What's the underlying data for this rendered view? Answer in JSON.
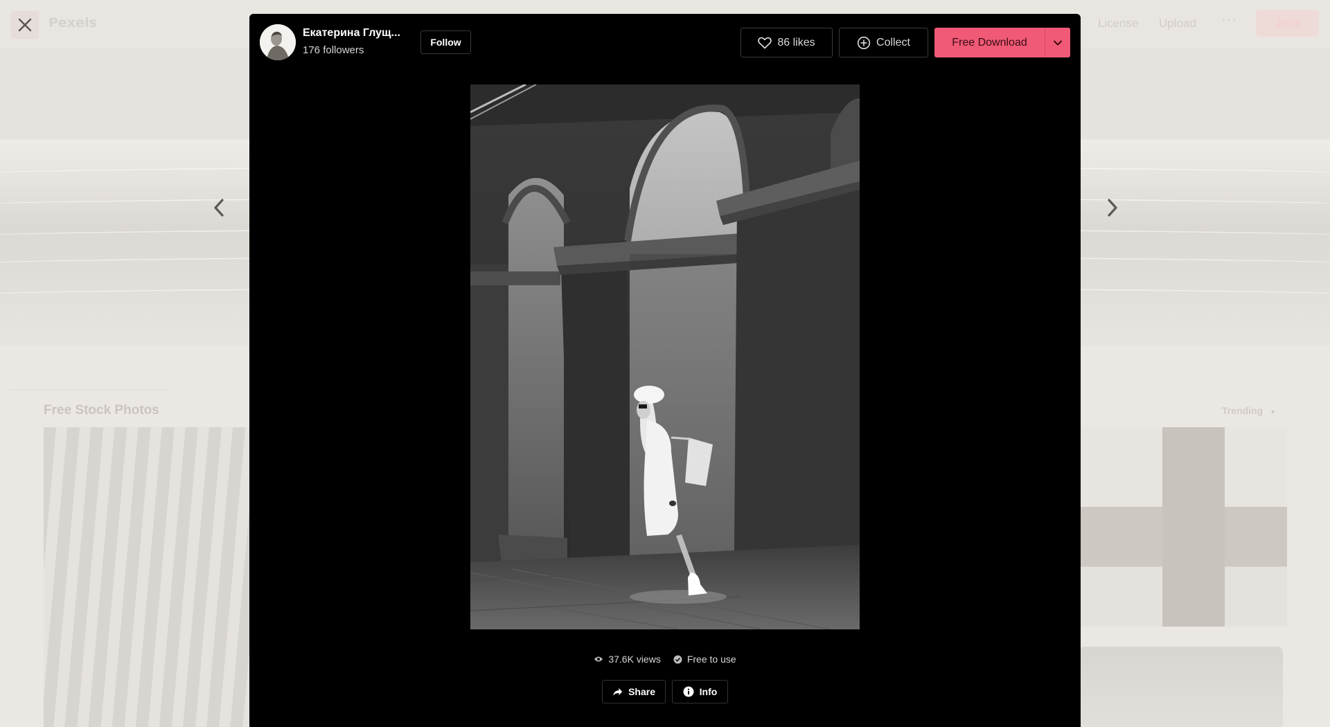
{
  "background_page": {
    "logo": "Pexels",
    "nav": {
      "license": "License",
      "upload": "Upload",
      "more": "···",
      "join": "Join"
    },
    "section_title": "Free Stock Photos",
    "sort": "Trending"
  },
  "modal": {
    "author": {
      "name": "Екатерина Глущ...",
      "followers": "176 followers"
    },
    "follow_label": "Follow",
    "likes_label": "86 likes",
    "collect_label": "Collect",
    "download_label": "Free Download",
    "views": "37.6K views",
    "license": "Free to use",
    "share_label": "Share",
    "info_label": "Info"
  },
  "colors": {
    "accent": "#f05a76",
    "modal_bg": "#000000",
    "overlay": "#e9e6e2"
  },
  "icons": {
    "close": "close-icon",
    "prev": "chevron-left-icon",
    "next": "chevron-right-icon",
    "likes": "heart-icon",
    "collect": "plus-circle-icon",
    "download_toggle": "chevron-down-icon",
    "views": "eye-icon",
    "license": "check-circle-icon",
    "share": "share-arrow-icon",
    "info": "info-icon"
  }
}
